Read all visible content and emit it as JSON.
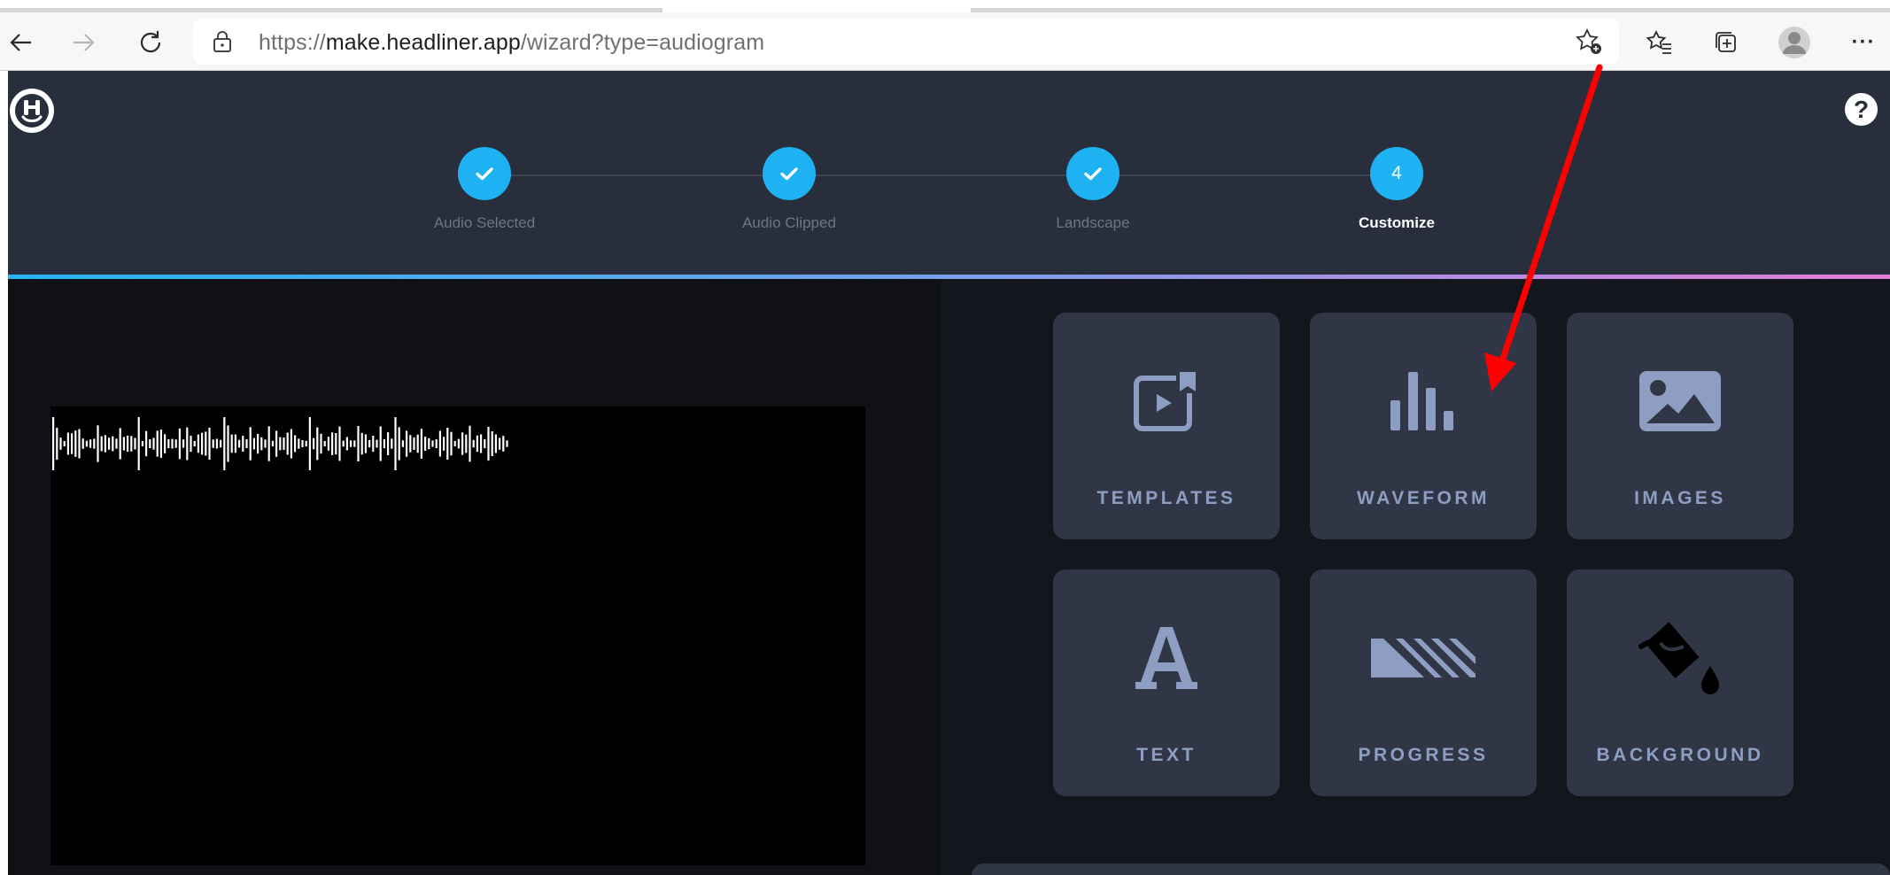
{
  "browser": {
    "url_scheme": "https://",
    "url_host": "make.headliner.app",
    "url_path": "/wizard?type=audiogram",
    "more_label": "···"
  },
  "app": {
    "help_label": "?",
    "steps": [
      {
        "label": "Audio Selected",
        "state": "done"
      },
      {
        "label": "Audio Clipped",
        "state": "done"
      },
      {
        "label": "Landscape",
        "state": "done"
      },
      {
        "label": "Customize",
        "state": "active",
        "number": "4"
      }
    ],
    "tools": [
      {
        "label": "TEMPLATES",
        "icon": "templates-icon"
      },
      {
        "label": "WAVEFORM",
        "icon": "waveform-icon"
      },
      {
        "label": "IMAGES",
        "icon": "image-icon"
      },
      {
        "label": "TEXT",
        "icon": "text-icon"
      },
      {
        "label": "PROGRESS",
        "icon": "progress-icon"
      },
      {
        "label": "BACKGROUND",
        "icon": "paint-bucket-icon"
      }
    ]
  },
  "colors": {
    "accent": "#1fb2f2",
    "header_bg": "#282e3b",
    "tile_bg": "#303645",
    "tile_text": "#8d9ec2",
    "annotation_arrow": "#ff0000"
  }
}
